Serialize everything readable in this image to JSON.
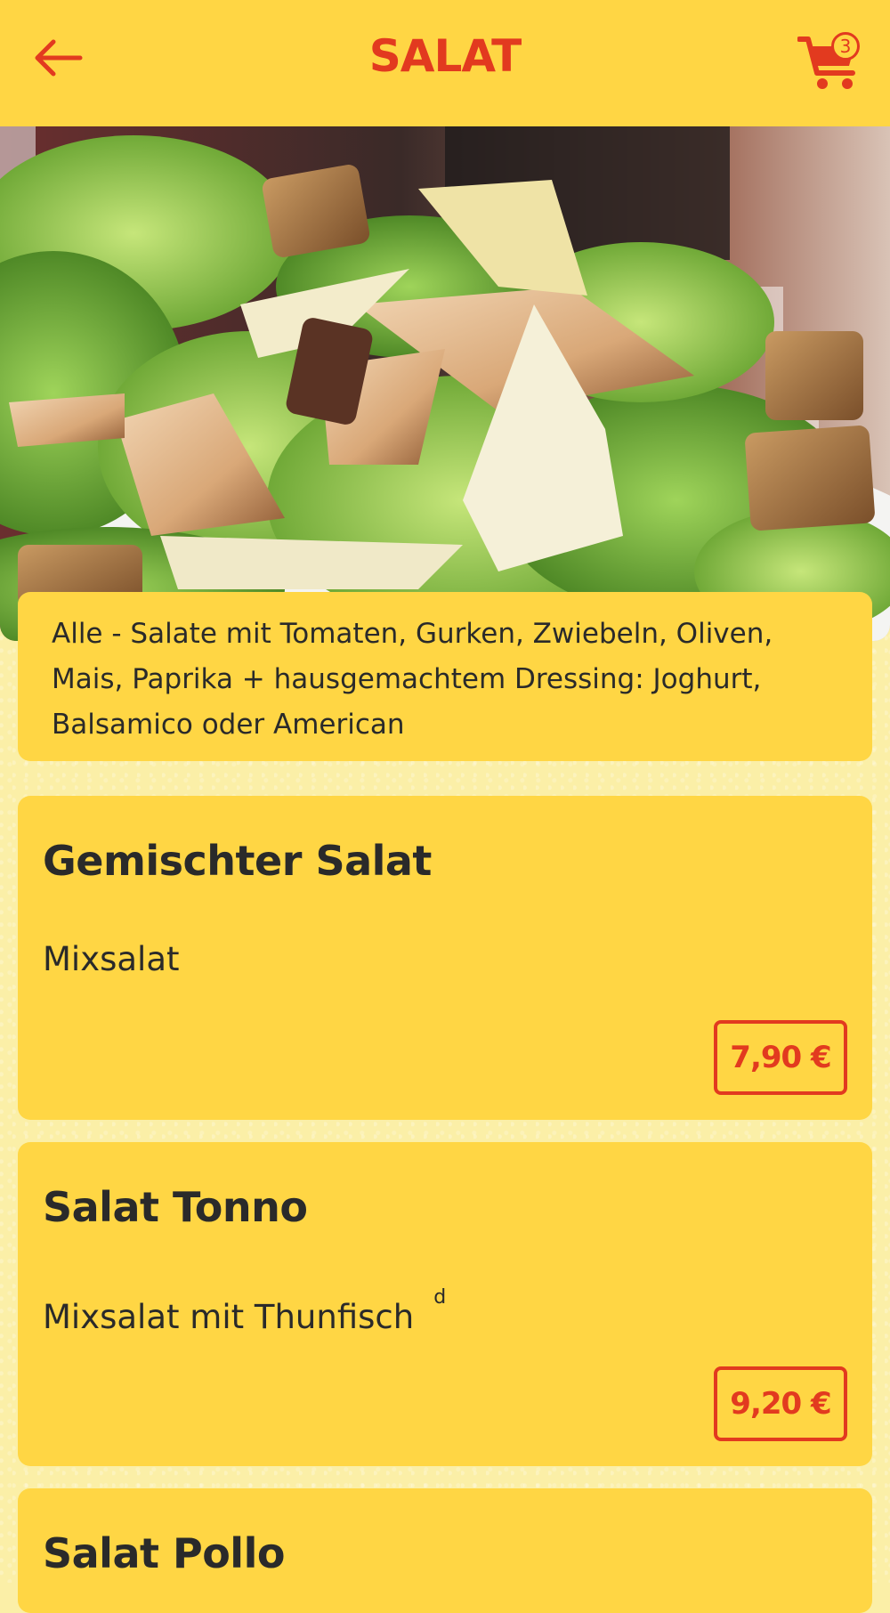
{
  "header": {
    "title": "SALAT",
    "back_icon": "arrow-left-icon",
    "cart_icon": "shopping-cart-icon",
    "cart_count": "3"
  },
  "hero": {
    "image": "salad-photo"
  },
  "info": {
    "text": "Alle - Salate mit Tomaten, Gurken, Zwiebeln, Oliven, Mais, Paprika + hausgemachtem Dressing: Joghurt, Balsamico oder American"
  },
  "products": [
    {
      "name": "Gemischter Salat",
      "description": "Mixsalat",
      "note": "",
      "price": "7,90 €"
    },
    {
      "name": "Salat Tonno",
      "description": "Mixsalat mit Thunfisch",
      "note": "d",
      "price": "9,20 €"
    },
    {
      "name": "Salat Pollo"
    }
  ],
  "colors": {
    "header_bg": "#FFD644",
    "accent": "#E23A1F",
    "page_bg": "#FBEFA7",
    "text": "#2a2a2a"
  }
}
